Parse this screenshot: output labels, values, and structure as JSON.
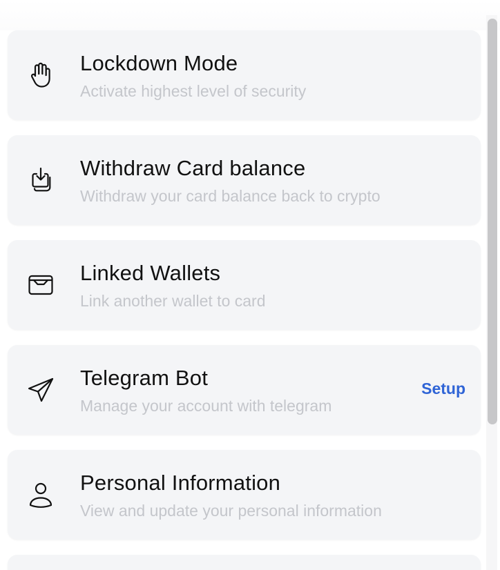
{
  "settings": {
    "items": [
      {
        "icon": "hand-icon",
        "title": "Lockdown Mode",
        "subtitle": "Activate highest level of security",
        "action": ""
      },
      {
        "icon": "withdraw-icon",
        "title": "Withdraw Card balance",
        "subtitle": "Withdraw your card balance back to crypto",
        "action": ""
      },
      {
        "icon": "wallet-icon",
        "title": "Linked Wallets",
        "subtitle": "Link another wallet to card",
        "action": ""
      },
      {
        "icon": "send-icon",
        "title": "Telegram Bot",
        "subtitle": "Manage your account with telegram",
        "action": "Setup"
      },
      {
        "icon": "user-icon",
        "title": "Personal Information",
        "subtitle": "View and update your personal information",
        "action": ""
      }
    ]
  },
  "colors": {
    "card_background": "#f4f5f7",
    "title_text": "#111111",
    "subtitle_text": "#c4c6cb",
    "accent": "#2f64d6",
    "scrollbar_thumb": "#c7c7c9"
  }
}
